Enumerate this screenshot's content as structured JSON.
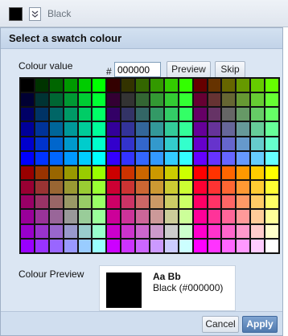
{
  "toolbar": {
    "current_color": "#000000",
    "label": "Black"
  },
  "dialog": {
    "title": "Select a swatch colour",
    "colour_value_label": "Colour value",
    "hash": "#",
    "colour_value": "000000",
    "preview_button": "Preview",
    "skip_button": "Skip",
    "swatches": [
      "#000000",
      "#003300",
      "#006600",
      "#009900",
      "#00cc00",
      "#00ff00",
      "#330000",
      "#333300",
      "#336600",
      "#339900",
      "#33cc00",
      "#33ff00",
      "#660000",
      "#663300",
      "#666600",
      "#669900",
      "#66cc00",
      "#66ff00",
      "#000033",
      "#003333",
      "#006633",
      "#009933",
      "#00cc33",
      "#00ff33",
      "#330033",
      "#333333",
      "#336633",
      "#339933",
      "#33cc33",
      "#33ff33",
      "#660033",
      "#663333",
      "#666633",
      "#669933",
      "#66cc33",
      "#66ff33",
      "#000066",
      "#003366",
      "#006666",
      "#009966",
      "#00cc66",
      "#00ff66",
      "#330066",
      "#333366",
      "#336666",
      "#339966",
      "#33cc66",
      "#33ff66",
      "#660066",
      "#663366",
      "#666666",
      "#669966",
      "#66cc66",
      "#66ff66",
      "#000099",
      "#003399",
      "#006699",
      "#009999",
      "#00cc99",
      "#00ff99",
      "#330099",
      "#333399",
      "#336699",
      "#339999",
      "#33cc99",
      "#33ff99",
      "#660099",
      "#663399",
      "#666699",
      "#669999",
      "#66cc99",
      "#66ff99",
      "#0000cc",
      "#0033cc",
      "#0066cc",
      "#0099cc",
      "#00cccc",
      "#00ffcc",
      "#3300cc",
      "#3333cc",
      "#3366cc",
      "#3399cc",
      "#33cccc",
      "#33ffcc",
      "#6600cc",
      "#6633cc",
      "#6666cc",
      "#6699cc",
      "#66cccc",
      "#66ffcc",
      "#0000ff",
      "#0033ff",
      "#0066ff",
      "#0099ff",
      "#00ccff",
      "#00ffff",
      "#3300ff",
      "#3333ff",
      "#3366ff",
      "#3399ff",
      "#33ccff",
      "#33ffff",
      "#6600ff",
      "#6633ff",
      "#6666ff",
      "#6699ff",
      "#66ccff",
      "#66ffff",
      "#990000",
      "#993300",
      "#996600",
      "#999900",
      "#99cc00",
      "#99ff00",
      "#cc0000",
      "#cc3300",
      "#cc6600",
      "#cc9900",
      "#cccc00",
      "#ccff00",
      "#ff0000",
      "#ff3300",
      "#ff6600",
      "#ff9900",
      "#ffcc00",
      "#ffff00",
      "#990033",
      "#993333",
      "#996633",
      "#999933",
      "#99cc33",
      "#99ff33",
      "#cc0033",
      "#cc3333",
      "#cc6633",
      "#cc9933",
      "#cccc33",
      "#ccff33",
      "#ff0033",
      "#ff3333",
      "#ff6633",
      "#ff9933",
      "#ffcc33",
      "#ffff33",
      "#990066",
      "#993366",
      "#996666",
      "#999966",
      "#99cc66",
      "#99ff66",
      "#cc0066",
      "#cc3366",
      "#cc6666",
      "#cc9966",
      "#cccc66",
      "#ccff66",
      "#ff0066",
      "#ff3366",
      "#ff6666",
      "#ff9966",
      "#ffcc66",
      "#ffff66",
      "#990099",
      "#993399",
      "#996699",
      "#999999",
      "#99cc99",
      "#99ff99",
      "#cc0099",
      "#cc3399",
      "#cc6699",
      "#cc9999",
      "#cccc99",
      "#ccff99",
      "#ff0099",
      "#ff3399",
      "#ff6699",
      "#ff9999",
      "#ffcc99",
      "#ffff99",
      "#9900cc",
      "#9933cc",
      "#9966cc",
      "#9999cc",
      "#99cccc",
      "#99ffcc",
      "#cc00cc",
      "#cc33cc",
      "#cc66cc",
      "#cc99cc",
      "#cccccc",
      "#ccffcc",
      "#ff00cc",
      "#ff33cc",
      "#ff66cc",
      "#ff99cc",
      "#ffcccc",
      "#ffffcc",
      "#9900ff",
      "#9933ff",
      "#9966ff",
      "#9999ff",
      "#99ccff",
      "#99ffff",
      "#cc00ff",
      "#cc33ff",
      "#cc66ff",
      "#cc99ff",
      "#ccccff",
      "#ccffff",
      "#ff00ff",
      "#ff33ff",
      "#ff66ff",
      "#ff99ff",
      "#ffccff",
      "#ffffff"
    ],
    "colour_preview_label": "Colour Preview",
    "preview_sample": "Aa Bb",
    "preview_name": "Black (#000000)",
    "cancel_button": "Cancel",
    "apply_button": "Apply"
  }
}
